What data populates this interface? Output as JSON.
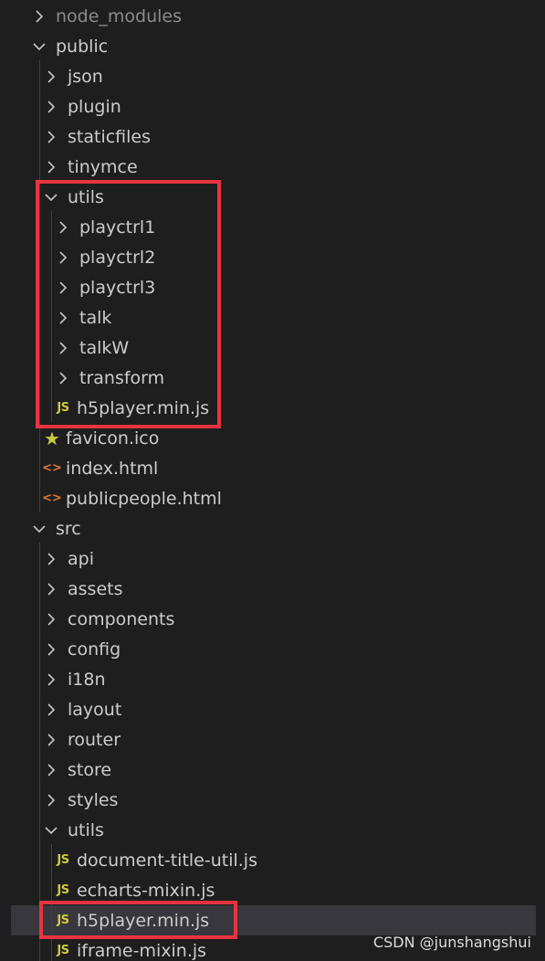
{
  "explorer": {
    "rows": [
      {
        "label": "node_modules",
        "kind": "folder",
        "open": false,
        "depth": 0,
        "dim": true
      },
      {
        "label": "public",
        "kind": "folder",
        "open": true,
        "depth": 0
      },
      {
        "label": "json",
        "kind": "folder",
        "open": false,
        "depth": 1
      },
      {
        "label": "plugin",
        "kind": "folder",
        "open": false,
        "depth": 1
      },
      {
        "label": "staticfiles",
        "kind": "folder",
        "open": false,
        "depth": 1
      },
      {
        "label": "tinymce",
        "kind": "folder",
        "open": false,
        "depth": 1
      },
      {
        "label": "utils",
        "kind": "folder",
        "open": true,
        "depth": 1
      },
      {
        "label": "playctrl1",
        "kind": "folder",
        "open": false,
        "depth": 2
      },
      {
        "label": "playctrl2",
        "kind": "folder",
        "open": false,
        "depth": 2
      },
      {
        "label": "playctrl3",
        "kind": "folder",
        "open": false,
        "depth": 2
      },
      {
        "label": "talk",
        "kind": "folder",
        "open": false,
        "depth": 2
      },
      {
        "label": "talkW",
        "kind": "folder",
        "open": false,
        "depth": 2
      },
      {
        "label": "transform",
        "kind": "folder",
        "open": false,
        "depth": 2
      },
      {
        "label": "h5player.min.js",
        "kind": "js",
        "depth": 2
      },
      {
        "label": "favicon.ico",
        "kind": "star",
        "depth": 1
      },
      {
        "label": "index.html",
        "kind": "html",
        "depth": 1
      },
      {
        "label": "publicpeople.html",
        "kind": "html",
        "depth": 1
      },
      {
        "label": "src",
        "kind": "folder",
        "open": true,
        "depth": 0
      },
      {
        "label": "api",
        "kind": "folder",
        "open": false,
        "depth": 1
      },
      {
        "label": "assets",
        "kind": "folder",
        "open": false,
        "depth": 1
      },
      {
        "label": "components",
        "kind": "folder",
        "open": false,
        "depth": 1
      },
      {
        "label": "config",
        "kind": "folder",
        "open": false,
        "depth": 1
      },
      {
        "label": "i18n",
        "kind": "folder",
        "open": false,
        "depth": 1
      },
      {
        "label": "layout",
        "kind": "folder",
        "open": false,
        "depth": 1
      },
      {
        "label": "router",
        "kind": "folder",
        "open": false,
        "depth": 1
      },
      {
        "label": "store",
        "kind": "folder",
        "open": false,
        "depth": 1
      },
      {
        "label": "styles",
        "kind": "folder",
        "open": false,
        "depth": 1
      },
      {
        "label": "utils",
        "kind": "folder",
        "open": true,
        "depth": 1
      },
      {
        "label": "document-title-util.js",
        "kind": "js",
        "depth": 2
      },
      {
        "label": "echarts-mixin.js",
        "kind": "js",
        "depth": 2
      },
      {
        "label": "h5player.min.js",
        "kind": "js",
        "depth": 2,
        "selected": true
      },
      {
        "label": "iframe-mixin.js",
        "kind": "js",
        "depth": 2
      }
    ],
    "icons": {
      "js": "JS",
      "html": "<>",
      "star": "★"
    },
    "colors": {
      "background": "#1e1e1e",
      "text": "#cccccc",
      "js": "#cbcb41",
      "html": "#e37933",
      "highlight": "#e8343f",
      "selected": "#37373d"
    }
  },
  "watermark": "CSDN @junshangshui"
}
